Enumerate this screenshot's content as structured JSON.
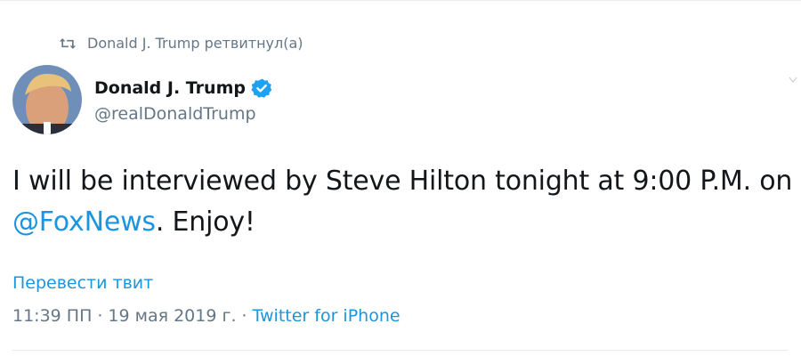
{
  "retweet": {
    "label": "Donald J. Trump ретвитнул(а)",
    "icon": "retweet-icon"
  },
  "author": {
    "name": "Donald J. Trump",
    "handle": "@realDonaldTrump",
    "verified": true
  },
  "tweet": {
    "text_before": "I will be interviewed by Steve Hilton tonight at 9:00 P.M. on ",
    "mention": "@FoxNews",
    "text_after": ". Enjoy!"
  },
  "translate_label": "Перевести твит",
  "meta": {
    "time": "11:39 ПП",
    "separator": "·",
    "date": "19 мая 2019 г.",
    "source": "Twitter for iPhone"
  },
  "colors": {
    "link": "#1b95e0",
    "secondary": "#657786",
    "verified": "#1da1f2"
  }
}
